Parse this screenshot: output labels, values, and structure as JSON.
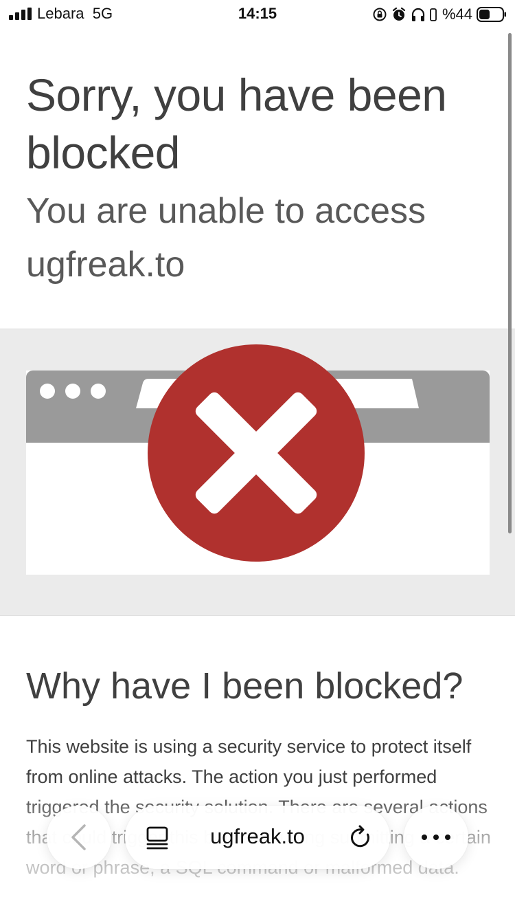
{
  "status_bar": {
    "carrier": "Lebara",
    "network": "5G",
    "time": "14:15",
    "battery_percent": "%44",
    "icons": [
      "signal-icon",
      "rotation-lock-icon",
      "alarm-icon",
      "headphones-icon",
      "battery-icon"
    ]
  },
  "page": {
    "title": "Sorry, you have been blocked",
    "subtitle": "You are unable to access ugfreak.to",
    "why_heading": "Why have I been blocked?",
    "why_text": "This website is using a security service to protect itself from online attacks. The action you just performed triggered the security solution. There are several actions that could trigger this block including submitting a certain word or phrase, a SQL command or malformed data."
  },
  "browser": {
    "address": "ugfreak.to",
    "icons": [
      "back-chevron-icon",
      "tabs-icon",
      "reload-icon",
      "more-dots-icon"
    ]
  },
  "colors": {
    "error_red": "#B0312E",
    "window_bar": "#9A9A9A",
    "section_bg": "#EBEBEB",
    "text": "#404040"
  }
}
